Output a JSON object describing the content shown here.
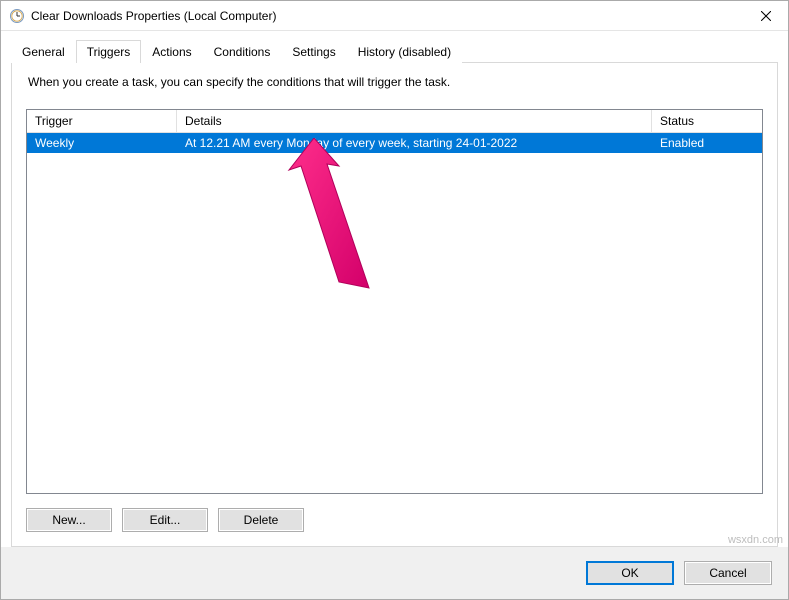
{
  "window": {
    "title": "Clear Downloads Properties (Local Computer)"
  },
  "tabs": {
    "general": "General",
    "triggers": "Triggers",
    "actions": "Actions",
    "conditions": "Conditions",
    "settings": "Settings",
    "history": "History (disabled)",
    "active": "triggers"
  },
  "triggers_panel": {
    "help_text": "When you create a task, you can specify the conditions that will trigger the task.",
    "columns": {
      "trigger": "Trigger",
      "details": "Details",
      "status": "Status"
    },
    "rows": [
      {
        "trigger": "Weekly",
        "details": "At 12.21 AM every Monday of every week, starting 24-01-2022",
        "status": "Enabled",
        "selected": true
      }
    ],
    "buttons": {
      "new": "New...",
      "edit": "Edit...",
      "delete": "Delete"
    }
  },
  "footer": {
    "ok": "OK",
    "cancel": "Cancel"
  },
  "colors": {
    "selection": "#0078d7",
    "chrome_border": "#d9d9d9",
    "annotation": "#ec1e79"
  },
  "watermark": "wsxdn.com"
}
